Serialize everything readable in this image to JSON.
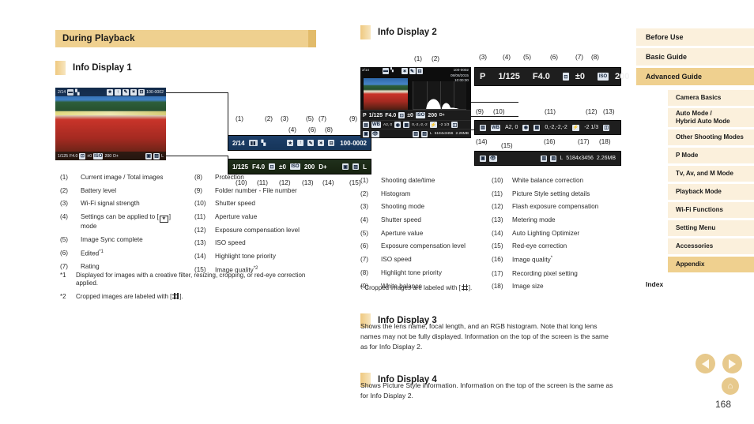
{
  "section": {
    "title": "During Playback"
  },
  "display1": {
    "heading": "Info Display 1",
    "camera": {
      "top_bar": {
        "counter": "2/14",
        "folder_file": "100-0002"
      },
      "bottom_bar": {
        "shutter": "1/125",
        "aperture": "F4.0",
        "exposure": "±0",
        "iso": "200",
        "highlight": "D+",
        "quality": "L"
      }
    },
    "callouts_top": [
      "(1)",
      "(2)",
      "(3)",
      "(4)",
      "(5)",
      "(6)",
      "(7)",
      "(8)",
      "(9)"
    ],
    "callouts_bottom": [
      "(10)",
      "(11)",
      "(12)",
      "(13)",
      "(14)",
      "(15)"
    ],
    "legend_a": [
      {
        "num": "(1)",
        "text": "Current image / Total images"
      },
      {
        "num": "(2)",
        "text": "Battery level"
      },
      {
        "num": "(3)",
        "text": "Wi-Fi signal strength"
      },
      {
        "num": "(4)",
        "text": "Settings can be applied to [  ] mode"
      },
      {
        "num": "(5)",
        "text": "Image Sync complete"
      },
      {
        "num": "(6)",
        "text": "Edited*1"
      },
      {
        "num": "(7)",
        "text": "Rating"
      }
    ],
    "legend_b": [
      {
        "num": "(8)",
        "text": "Protection"
      },
      {
        "num": "(9)",
        "text": "Folder number - File number"
      },
      {
        "num": "(10)",
        "text": "Shutter speed"
      },
      {
        "num": "(11)",
        "text": "Aperture value"
      },
      {
        "num": "(12)",
        "text": "Exposure compensation level"
      },
      {
        "num": "(13)",
        "text": "ISO speed"
      },
      {
        "num": "(14)",
        "text": "Highlight tone priority"
      },
      {
        "num": "(15)",
        "text": "Image quality*2"
      }
    ],
    "footnotes": [
      {
        "num": "*1",
        "text": "Displayed for images with a creative filter, resizing, cropping, or red-eye correction applied."
      },
      {
        "num": "*2",
        "text": "Cropped images are labeled with [   ]."
      }
    ]
  },
  "display2": {
    "heading": "Info Display 2",
    "camera": {
      "counter": "2/14",
      "folder_file": "100-0002",
      "date": "08/08/2015",
      "time": "10:00:00",
      "row1": {
        "mode": "P",
        "shutter": "1/125",
        "aperture": "F4.0",
        "exposure": "±0",
        "iso": "200",
        "highlight": "D+"
      },
      "row2": {
        "wb_corr": "A2, 0",
        "picture_style": "0,-2,-2,-2",
        "flash_comp": "-2 1/3"
      },
      "row3": {
        "quality": "L",
        "pixels": "5184x3456",
        "size": "2.26MB"
      }
    },
    "callouts_row0": [
      "(1)",
      "(2)"
    ],
    "callouts_row1": [
      "(3)",
      "(4)",
      "(5)",
      "(6)",
      "(7)",
      "(8)"
    ],
    "callouts_row2": [
      "(9)",
      "(10)",
      "(11)",
      "(12)",
      "(13)"
    ],
    "callouts_row3": [
      "(14)",
      "(15)",
      "(16)",
      "(17)",
      "(18)"
    ],
    "legend_a": [
      {
        "num": "(1)",
        "text": "Shooting date/time"
      },
      {
        "num": "(2)",
        "text": "Histogram"
      },
      {
        "num": "(3)",
        "text": "Shooting mode"
      },
      {
        "num": "(4)",
        "text": "Shutter speed"
      },
      {
        "num": "(5)",
        "text": "Aperture value"
      },
      {
        "num": "(6)",
        "text": "Exposure compensation level"
      },
      {
        "num": "(7)",
        "text": "ISO speed"
      },
      {
        "num": "(8)",
        "text": "Highlight tone priority"
      },
      {
        "num": "(9)",
        "text": "White balance"
      }
    ],
    "legend_b": [
      {
        "num": "(10)",
        "text": "White balance correction"
      },
      {
        "num": "(11)",
        "text": "Picture Style setting details"
      },
      {
        "num": "(12)",
        "text": "Flash exposure compensation"
      },
      {
        "num": "(13)",
        "text": "Metering mode"
      },
      {
        "num": "(14)",
        "text": "Auto Lighting Optimizer"
      },
      {
        "num": "(15)",
        "text": "Red-eye correction"
      },
      {
        "num": "(16)",
        "text": "Image quality*"
      },
      {
        "num": "(17)",
        "text": "Recording pixel setting"
      },
      {
        "num": "(18)",
        "text": "Image size"
      }
    ],
    "footnote": {
      "num": "*",
      "text": "Cropped images are labeled with [   ]."
    }
  },
  "display3": {
    "heading": "Info Display 3",
    "body": "Shows the lens name, focal length, and an RGB histogram. Note that long lens names may not be fully displayed. Information on the top of the screen is the same as for Info Display 2."
  },
  "display4": {
    "heading": "Info Display 4",
    "body": "Shows Picture Style information. Information on the top of the screen is the same as for Info Display 2."
  },
  "sidebar": {
    "top": [
      {
        "label": "Before Use",
        "active": false
      },
      {
        "label": "Basic Guide",
        "active": false
      },
      {
        "label": "Advanced Guide",
        "active": true
      }
    ],
    "sub": [
      {
        "label": "Camera Basics",
        "active": false
      },
      {
        "label": "Auto Mode / Hybrid Auto Mode",
        "active": false
      },
      {
        "label": "Other Shooting Modes",
        "active": false
      },
      {
        "label": "P Mode",
        "active": false
      },
      {
        "label": "Tv, Av, and M Mode",
        "active": false
      },
      {
        "label": "Playback Mode",
        "active": false
      },
      {
        "label": "Wi-Fi Functions",
        "active": false
      },
      {
        "label": "Setting Menu",
        "active": false
      },
      {
        "label": "Accessories",
        "active": false
      },
      {
        "label": "Appendix",
        "active": true
      }
    ],
    "index": {
      "label": "Index"
    }
  },
  "footer": {
    "page_number": "168",
    "home_glyph": "⌂"
  },
  "colors": {
    "accent": "#efd08f",
    "accent_light": "#fbf0dc",
    "accent_cap": "#e2bb6a"
  }
}
